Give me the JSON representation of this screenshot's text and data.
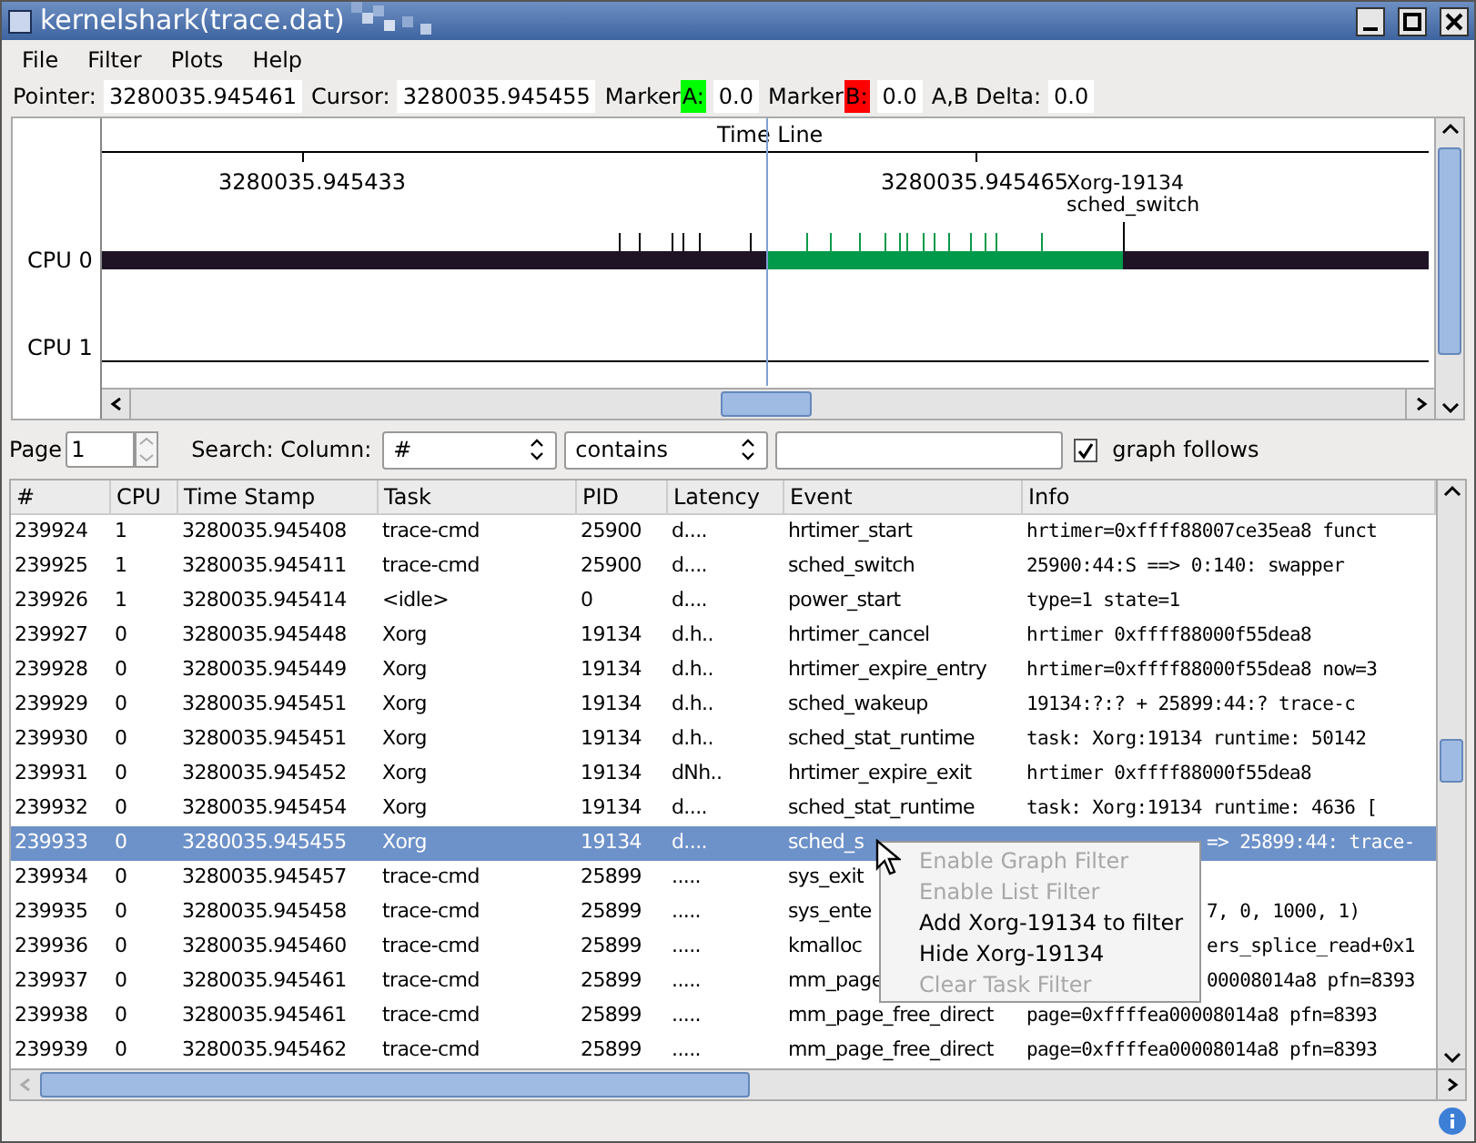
{
  "window": {
    "title": "kernelshark(trace.dat)"
  },
  "menu": [
    "File",
    "Filter",
    "Plots",
    "Help"
  ],
  "info_bar": [
    {
      "label": "Pointer:",
      "value": "3280035.945461"
    },
    {
      "label": "Cursor:",
      "value": "3280035.945455"
    },
    {
      "label": "Marker",
      "marker": "A:",
      "color": "#00ff00",
      "value": "0.0"
    },
    {
      "label": "Marker",
      "marker": "B:",
      "color": "#ff0000",
      "value": "0.0"
    },
    {
      "label": "A,B Delta:",
      "value": "0.0"
    }
  ],
  "graph": {
    "title": "Time Line",
    "ticks": [
      "3280035.945433",
      "3280035.945465"
    ],
    "cpus": [
      "CPU 0",
      "CPU 1"
    ],
    "event_label": [
      "Xorg-19134",
      "sched_switch"
    ]
  },
  "search": {
    "page_label": "Page",
    "page": "1",
    "label": "Search: Column:",
    "column": "#",
    "operator": "contains",
    "graph_follows": {
      "label": "graph follows",
      "checked": true
    }
  },
  "table": {
    "columns": [
      "#",
      "CPU",
      "Time Stamp",
      "Task",
      "PID",
      "Latency",
      "Event",
      "Info"
    ],
    "rows": [
      {
        "cells": [
          "239924",
          "1",
          "3280035.945408",
          "trace-cmd",
          "25900",
          "d....",
          "hrtimer_start",
          "hrtimer=0xffff88007ce35ea8 funct"
        ],
        "selected": false
      },
      {
        "cells": [
          "239925",
          "1",
          "3280035.945411",
          "trace-cmd",
          "25900",
          "d....",
          "sched_switch",
          "25900:44:S ==> 0:140: swapper"
        ],
        "selected": false
      },
      {
        "cells": [
          "239926",
          "1",
          "3280035.945414",
          "<idle>",
          "0",
          "d....",
          "power_start",
          "type=1 state=1"
        ],
        "selected": false
      },
      {
        "cells": [
          "239927",
          "0",
          "3280035.945448",
          "Xorg",
          "19134",
          "d.h..",
          "hrtimer_cancel",
          "hrtimer 0xffff88000f55dea8"
        ],
        "selected": false
      },
      {
        "cells": [
          "239928",
          "0",
          "3280035.945449",
          "Xorg",
          "19134",
          "d.h..",
          "hrtimer_expire_entry",
          "hrtimer=0xffff88000f55dea8 now=3"
        ],
        "selected": false
      },
      {
        "cells": [
          "239929",
          "0",
          "3280035.945451",
          "Xorg",
          "19134",
          "d.h..",
          "sched_wakeup",
          "19134:?:? +   25899:44:? trace-c"
        ],
        "selected": false
      },
      {
        "cells": [
          "239930",
          "0",
          "3280035.945451",
          "Xorg",
          "19134",
          "d.h..",
          "sched_stat_runtime",
          "task: Xorg:19134 runtime: 50142"
        ],
        "selected": false
      },
      {
        "cells": [
          "239931",
          "0",
          "3280035.945452",
          "Xorg",
          "19134",
          "dNh..",
          "hrtimer_expire_exit",
          "hrtimer 0xffff88000f55dea8"
        ],
        "selected": false
      },
      {
        "cells": [
          "239932",
          "0",
          "3280035.945454",
          "Xorg",
          "19134",
          "d....",
          "sched_stat_runtime",
          "task: Xorg:19134 runtime: 4636 ["
        ],
        "selected": false
      },
      {
        "cells": [
          "239933",
          "0",
          "3280035.945455",
          "Xorg",
          "19134",
          "d....",
          "sched_s",
          "=> 25899:44: trace-"
        ],
        "selected": true
      },
      {
        "cells": [
          "239934",
          "0",
          "3280035.945457",
          "trace-cmd",
          "25899",
          ".....",
          "sys_exit"
        ],
        "selected": false
      },
      {
        "cells": [
          "239935",
          "0",
          "3280035.945458",
          "trace-cmd",
          "25899",
          ".....",
          "sys_ente",
          "7, 0, 1000, 1)"
        ],
        "selected": false
      },
      {
        "cells": [
          "239936",
          "0",
          "3280035.945460",
          "trace-cmd",
          "25899",
          ".....",
          "kmalloc",
          "ers_splice_read+0x1"
        ],
        "selected": false
      },
      {
        "cells": [
          "239937",
          "0",
          "3280035.945461",
          "trace-cmd",
          "25899",
          ".....",
          "mm_page",
          "00008014a8 pfn=8393"
        ],
        "selected": false
      },
      {
        "cells": [
          "239938",
          "0",
          "3280035.945461",
          "trace-cmd",
          "25899",
          ".....",
          "mm_page_free_direct",
          "page=0xffffea00008014a8 pfn=8393"
        ],
        "selected": false
      },
      {
        "cells": [
          "239939",
          "0",
          "3280035.945462",
          "trace-cmd",
          "25899",
          ".....",
          "mm_page_free_direct",
          "page=0xffffea00008014a8 pfn=8393"
        ],
        "selected": false
      }
    ]
  },
  "context_menu": [
    {
      "label": "Enable Graph Filter",
      "disabled": true
    },
    {
      "label": "Enable List Filter",
      "disabled": true
    },
    {
      "label": "Add Xorg-19134 to filter",
      "disabled": false
    },
    {
      "label": "Hide Xorg-19134",
      "disabled": false
    },
    {
      "label": "Clear Task Filter",
      "disabled": true
    }
  ]
}
